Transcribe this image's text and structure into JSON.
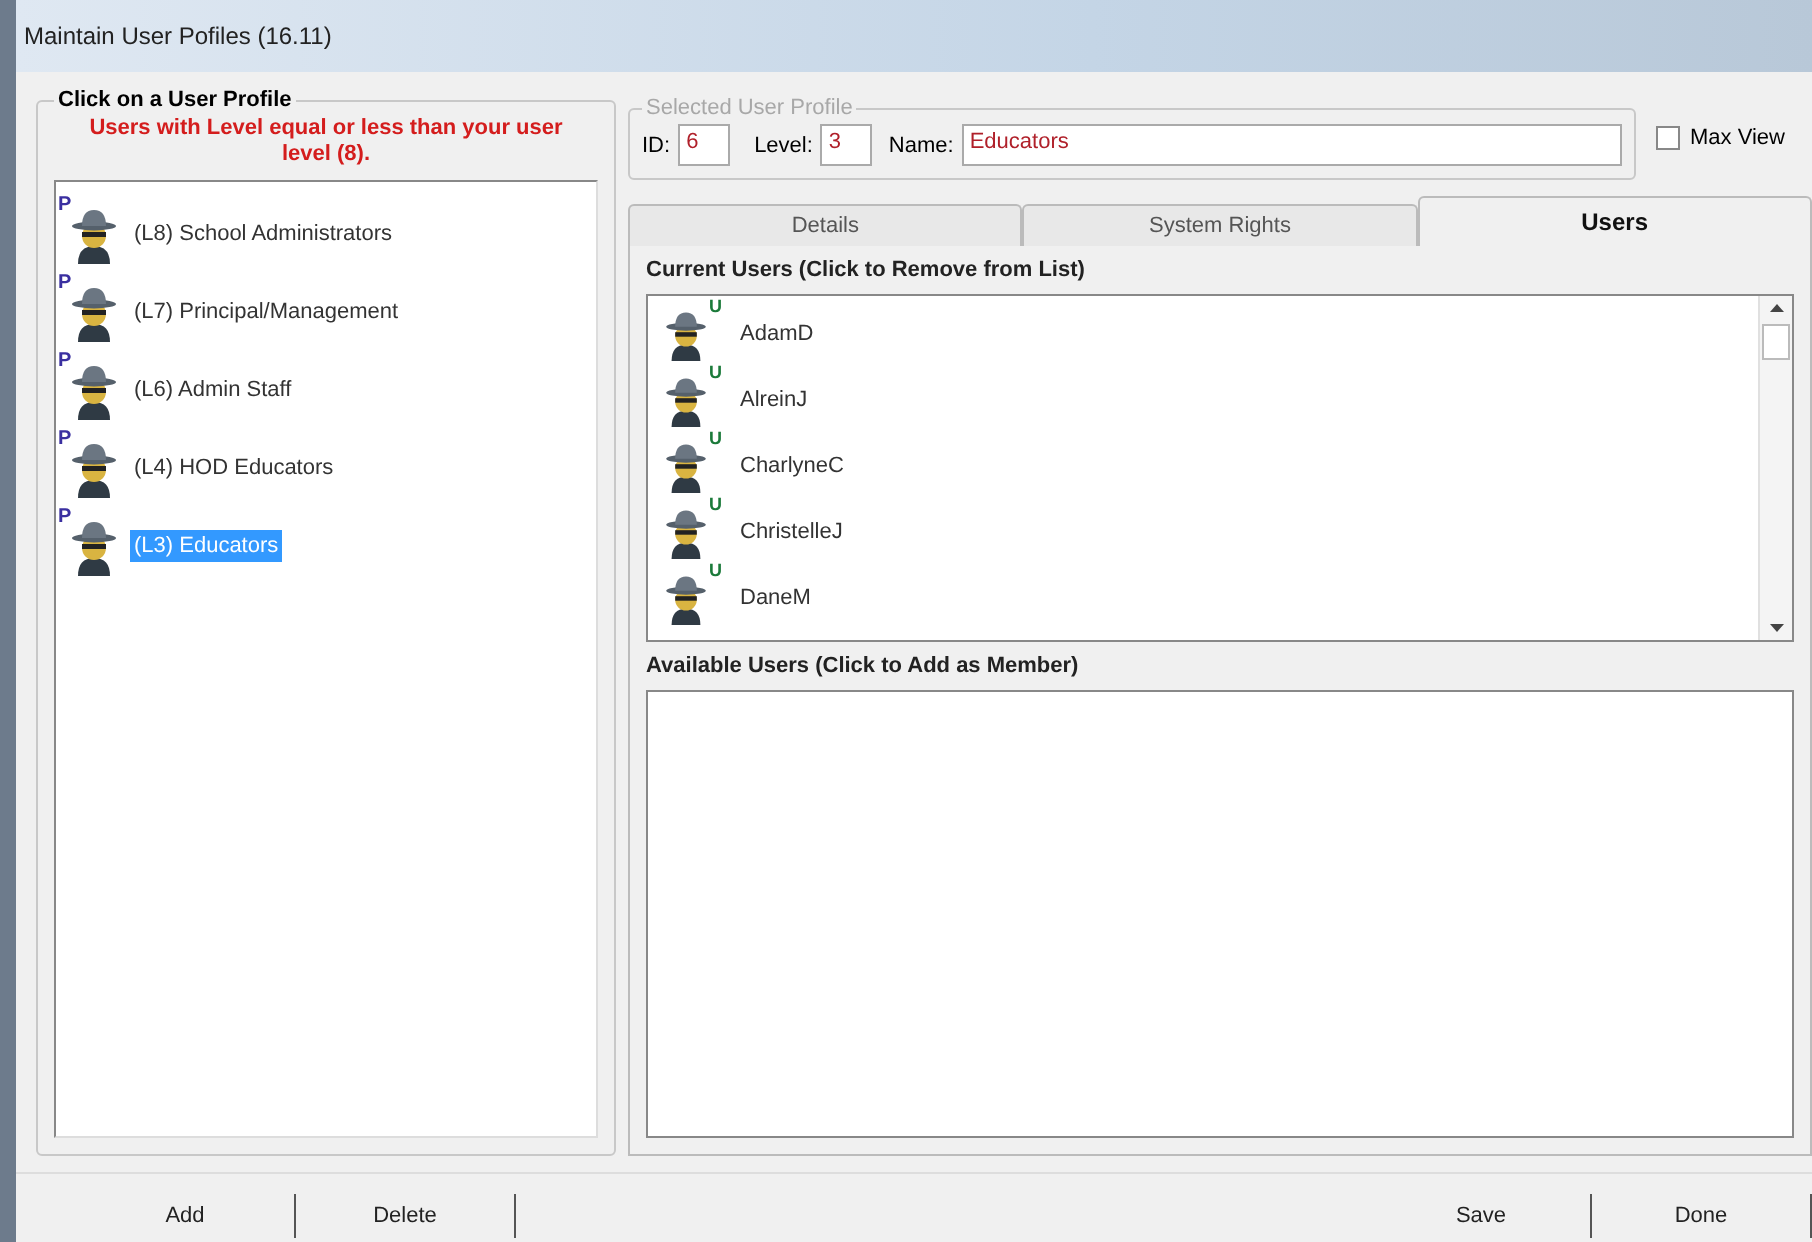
{
  "window": {
    "title": "Maintain User Pofiles (16.11)"
  },
  "profiles_panel": {
    "title": "Click on a User Profile",
    "note": "Users with Level equal or less than your user level (8).",
    "profiles": [
      {
        "badge": "P",
        "label": "(L8) School Administrators",
        "selected": false
      },
      {
        "badge": "P",
        "label": "(L7) Principal/Management",
        "selected": false
      },
      {
        "badge": "P",
        "label": "(L6) Admin Staff",
        "selected": false
      },
      {
        "badge": "P",
        "label": "(L4) HOD Educators",
        "selected": false
      },
      {
        "badge": "P",
        "label": "(L3) Educators",
        "selected": true
      }
    ]
  },
  "selected_profile": {
    "title": "Selected User Profile",
    "id_label": "ID:",
    "id": "6",
    "level_label": "Level:",
    "level_value": "3",
    "name_label": "Name:",
    "name": "Educators"
  },
  "max_view": {
    "label": "Max View",
    "checked": false
  },
  "tabs": [
    {
      "label": "Details",
      "selected": false
    },
    {
      "label": "System Rights",
      "selected": false
    },
    {
      "label": "Users",
      "selected": true
    }
  ],
  "current_users": {
    "title": "Current Users (Click to Remove from List)",
    "users": [
      {
        "badge": "U",
        "name": "AdamD"
      },
      {
        "badge": "U",
        "name": "AlreinJ"
      },
      {
        "badge": "U",
        "name": "CharlyneC"
      },
      {
        "badge": "U",
        "name": "ChristelleJ"
      },
      {
        "badge": "U",
        "name": "DaneM"
      }
    ]
  },
  "available_users": {
    "title": "Available Users (Click to Add as Member)"
  },
  "left_buttons": [
    {
      "label": "Add"
    },
    {
      "label": "Delete"
    }
  ],
  "right_buttons": [
    {
      "label": "Save"
    },
    {
      "label": "Done"
    }
  ]
}
